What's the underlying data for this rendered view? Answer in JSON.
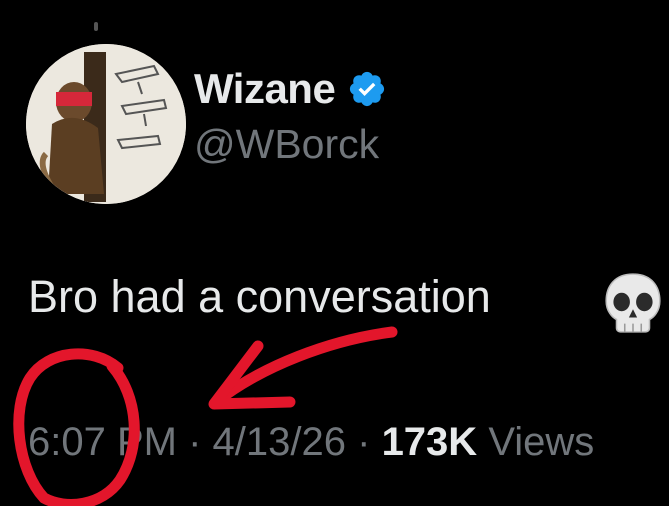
{
  "author": {
    "display_name": "Wizane",
    "handle": "@WBorck",
    "verified": true,
    "avatar_icon": "avatar-illustration"
  },
  "tweet": {
    "text": "Bro had a conversation",
    "emoji_icon": "skull-emoji",
    "time": "6:07 PM",
    "date": "4/13/26",
    "separator": "·",
    "views_count": "173K",
    "views_label": "Views"
  },
  "colors": {
    "background": "#000000",
    "primary_text": "#e7e9ea",
    "secondary_text": "#71767b",
    "verified_blue": "#1d9bf0",
    "annotation_red": "#e3162b"
  }
}
